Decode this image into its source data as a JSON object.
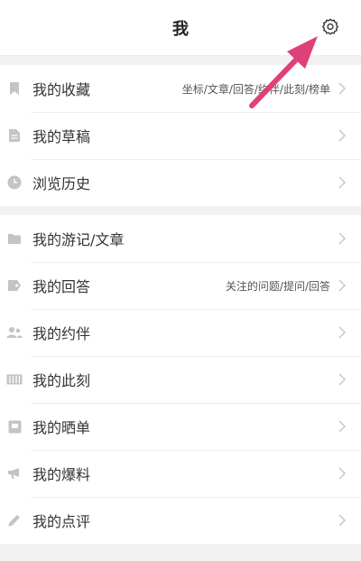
{
  "header": {
    "title": "我"
  },
  "group1": [
    {
      "label": "我的收藏",
      "sub": "坐标/文章/回答/约伴/此刻/榜单",
      "icon": "bookmark-icon"
    },
    {
      "label": "我的草稿",
      "sub": "",
      "icon": "draft-document-icon"
    },
    {
      "label": "浏览历史",
      "sub": "",
      "icon": "clock-icon"
    }
  ],
  "group2": [
    {
      "label": "我的游记/文章",
      "sub": "",
      "icon": "folder-icon"
    },
    {
      "label": "我的回答",
      "sub": "关注的问题/提问/回答",
      "icon": "answer-tag-icon"
    },
    {
      "label": "我的约伴",
      "sub": "",
      "icon": "people-icon"
    },
    {
      "label": "我的此刻",
      "sub": "",
      "icon": "film-strip-icon"
    },
    {
      "label": "我的晒单",
      "sub": "",
      "icon": "receipt-icon"
    },
    {
      "label": "我的爆料",
      "sub": "",
      "icon": "megaphone-icon"
    },
    {
      "label": "我的点评",
      "sub": "",
      "icon": "pencil-icon"
    }
  ],
  "colors": {
    "icon": "#c4c4c4",
    "chevron": "#c8c8c8",
    "annotation_arrow": "#e0407a"
  }
}
